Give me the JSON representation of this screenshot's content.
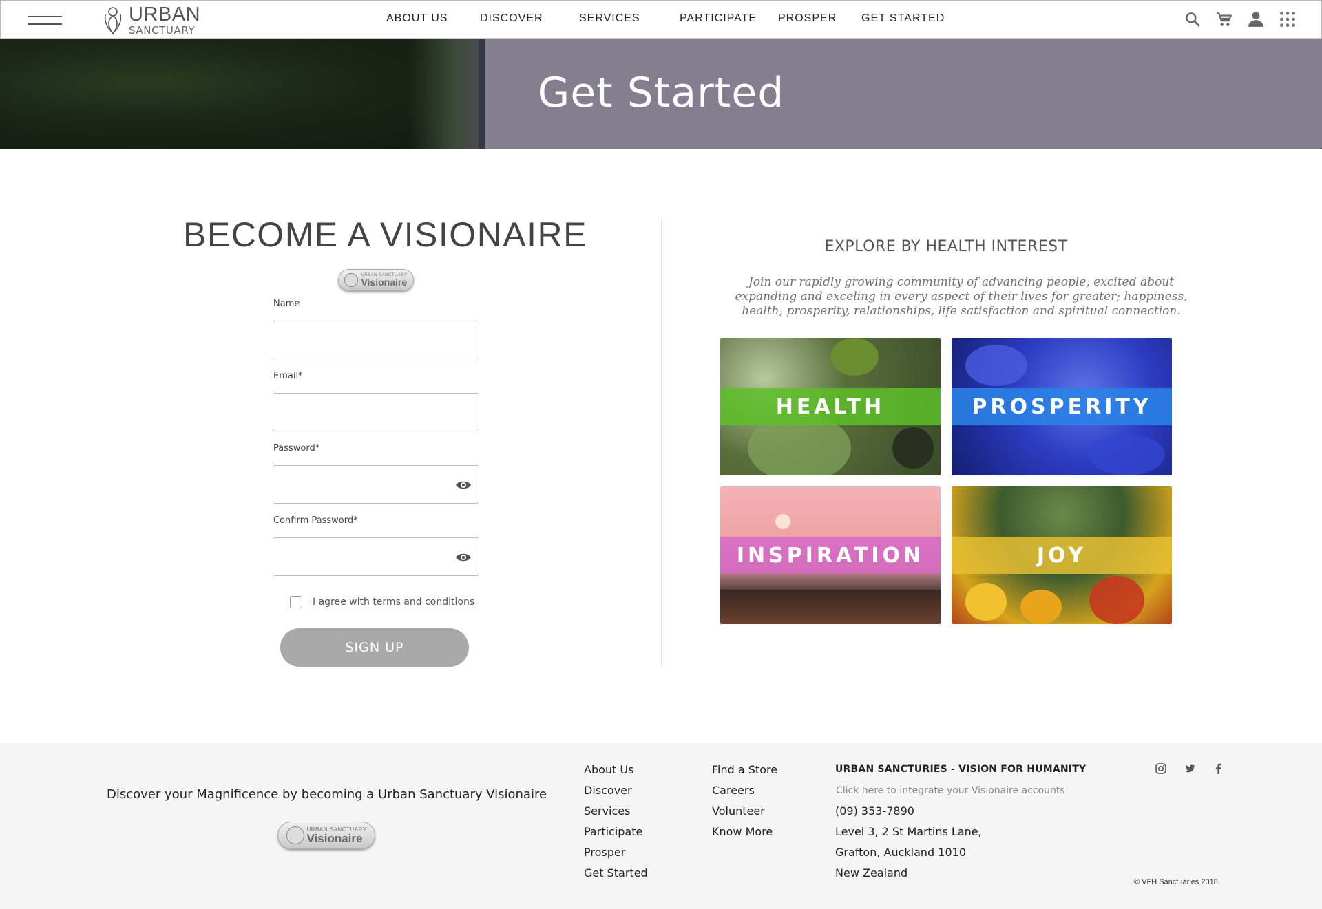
{
  "nav": {
    "logo_top": "URBAN",
    "logo_bottom": "SANCTUARY",
    "menu": [
      "ABOUT US",
      "DISCOVER",
      "SERVICES",
      "PARTICIPATE",
      "PROSPER",
      "GET STARTED"
    ],
    "icons": [
      "search-icon",
      "cart-icon",
      "user-icon",
      "apps-grid-icon"
    ]
  },
  "hero": {
    "title": "Get Started"
  },
  "form": {
    "heading": "BECOME A VISIONAIRE",
    "badge_small": "URBAN SANCTUARY",
    "badge_big": "Visionaire",
    "name_label": "Name",
    "email_label": "Email*",
    "password_label": "Password*",
    "confirm_label": "Confirm Password*",
    "terms": "I agree with terms and conditions",
    "signup": "SIGN UP"
  },
  "explore": {
    "heading": "EXPLORE BY HEALTH INTEREST",
    "intro": "Join our rapidly growing community of advancing people, excited about expanding and exceling in every aspect of their lives for greater; happiness, health, prosperity, relationships, life satisfaction and spiritual connection.",
    "tiles": [
      "HEALTH",
      "PROSPERITY",
      "INSPIRATION",
      "JOY"
    ]
  },
  "footer": {
    "tagline": "Discover your Magnificence by becoming a Urban Sanctuary Visionaire",
    "col1": [
      "About Us",
      "Discover",
      "Services",
      "Participate",
      "Prosper",
      "Get Started"
    ],
    "col2": [
      "Find a Store",
      "Careers",
      "Volunteer",
      "Know More"
    ],
    "heading": "URBAN SANCTURIES - VISION FOR HUMANITY",
    "integrate": "Click here to integrate your Visionaire accounts",
    "contact": [
      "(09) 353-7890",
      "Level 3, 2 St Martins Lane,",
      "Grafton, Auckland 1010",
      "New Zealand"
    ],
    "social": [
      "instagram-icon",
      "twitter-icon",
      "facebook-icon"
    ],
    "copyright": "© VFH Sanctuaries 2018"
  }
}
